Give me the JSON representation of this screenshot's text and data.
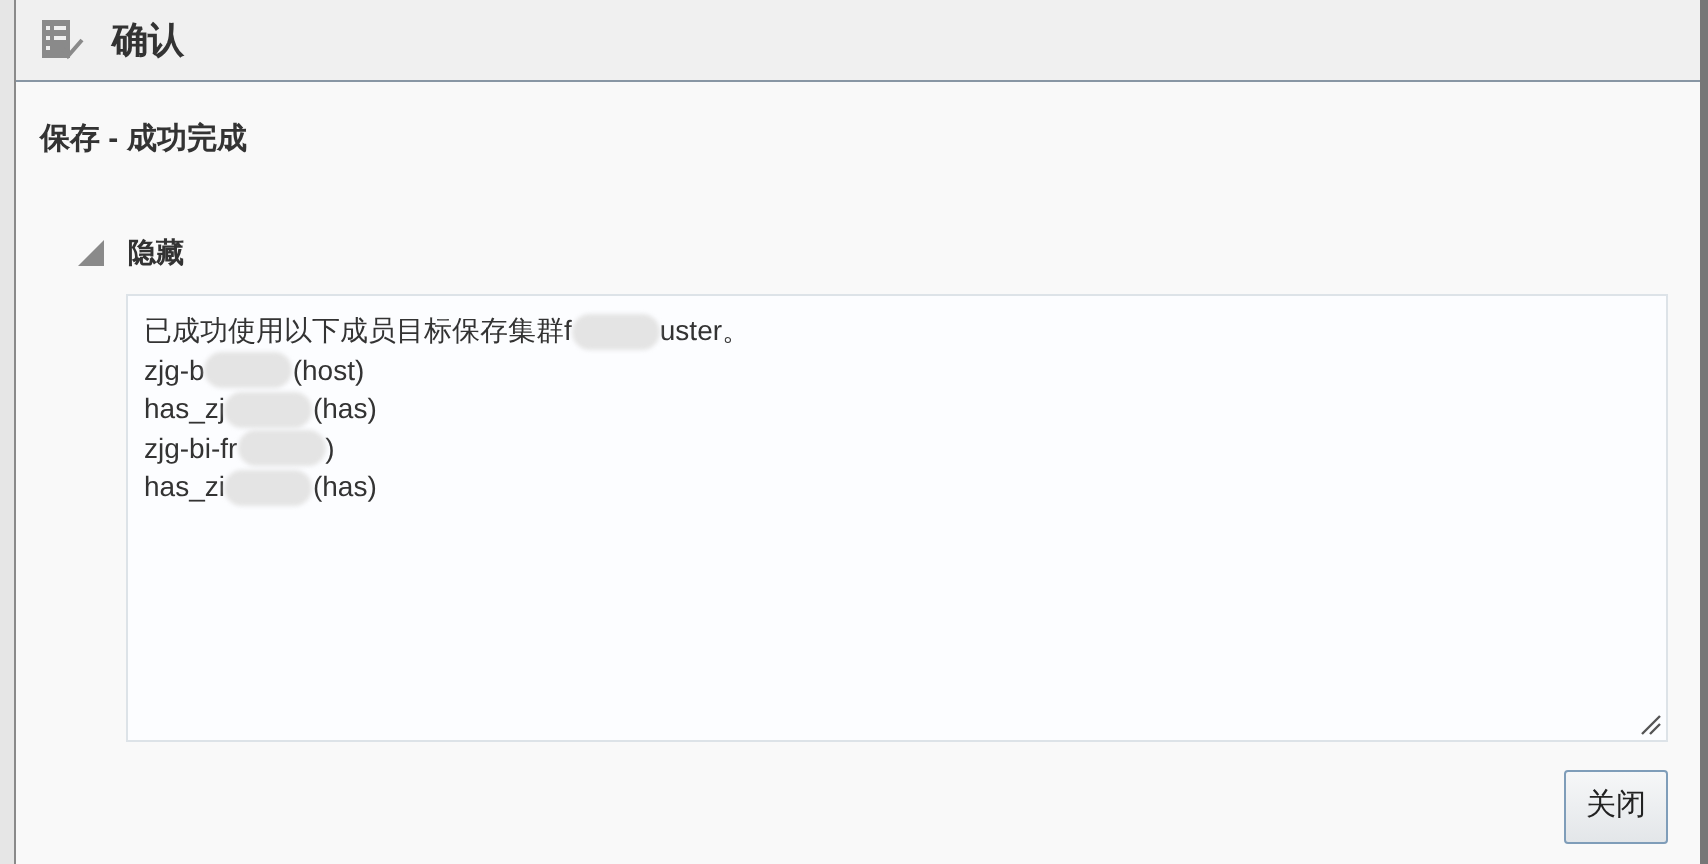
{
  "dialog": {
    "title": "确认",
    "status": "保存 - 成功完成"
  },
  "section": {
    "label": "隐藏",
    "expanded": true,
    "lines": [
      {
        "before": "已成功使用以下成员目标保存集群f",
        "after": "uster。"
      },
      {
        "before": "zjg-b",
        "after": "(host)"
      },
      {
        "before": "has_zj",
        "after": " (has)"
      },
      {
        "before": "zjg-bi-fr",
        "after": ")"
      },
      {
        "before": "has_zi",
        "after": "(has)"
      }
    ]
  },
  "buttons": [
    "关闭"
  ]
}
